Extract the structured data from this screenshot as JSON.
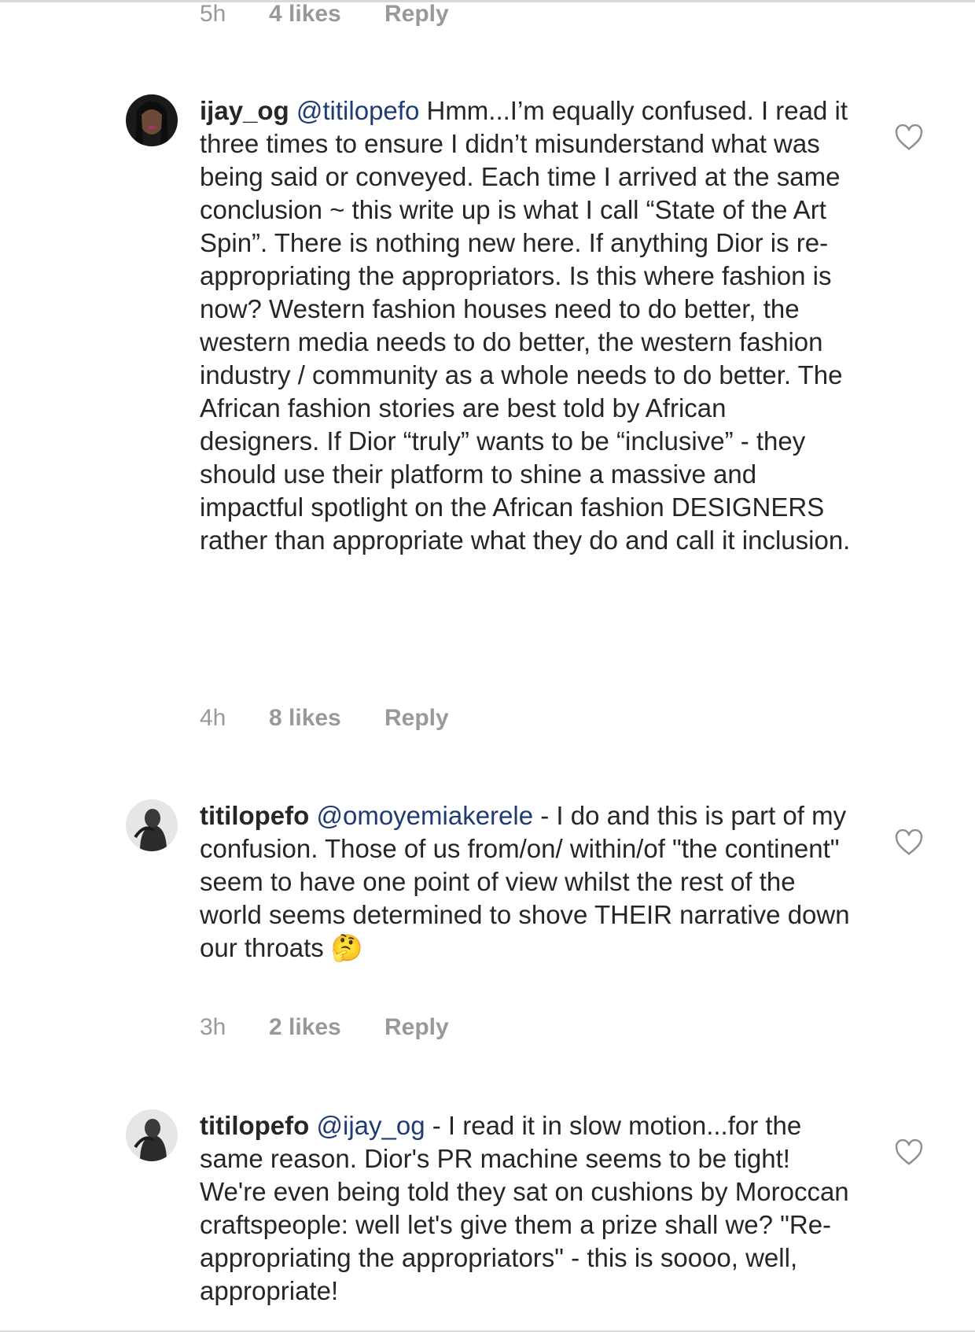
{
  "comments": [
    {
      "time": "5h",
      "likes": "4 likes",
      "reply": "Reply"
    },
    {
      "username": "ijay_og",
      "mention": "@titilopefo",
      "text": " Hmm...I’m equally confused. I read it three times to ensure I didn’t misunderstand what was being said or conveyed. Each time I arrived at the same conclusion ~ this write up is what I call “State of the Art Spin”. There is nothing new here. If anything Dior is re-appropriating the appropriators. Is this where fashion is now? Western fashion houses need to do better, the western media needs to do better, the western fashion industry / community as a whole needs to do better. The African fashion stories are best told by African designers. If Dior “truly” wants to be “inclusive” - they should use their platform to shine a massive and impactful spotlight on the African fashion DESIGNERS rather than appropriate what they do and call it inclusion.",
      "time": "4h",
      "likes": "8 likes",
      "reply": "Reply"
    },
    {
      "username": "titilopefo",
      "mention": "@omoyemiakerele",
      "text": " - I do and this is part of my confusion. Those of us from/on/ within/of \"the continent\" seem to have one point of view whilst the rest of the world seems determined to shove THEIR narrative down our throats 🤔",
      "time": "3h",
      "likes": "2 likes",
      "reply": "Reply"
    },
    {
      "username": "titilopefo",
      "mention": "@ijay_og",
      "text": " - I read it in slow motion...for the same reason. Dior's PR machine seems to be tight! We're even being told they sat on cushions by Moroccan craftspeople: well let's give them a prize shall we? \"Re-appropriating the appropriators\" - this is soooo, well, appropriate!"
    }
  ],
  "icons": {
    "heart": "heart-outline-icon",
    "avatar": "user-avatar"
  },
  "colors": {
    "text": "#262626",
    "mention": "#1f3b74",
    "meta": "#999999",
    "heart": "#8e8e8e"
  }
}
